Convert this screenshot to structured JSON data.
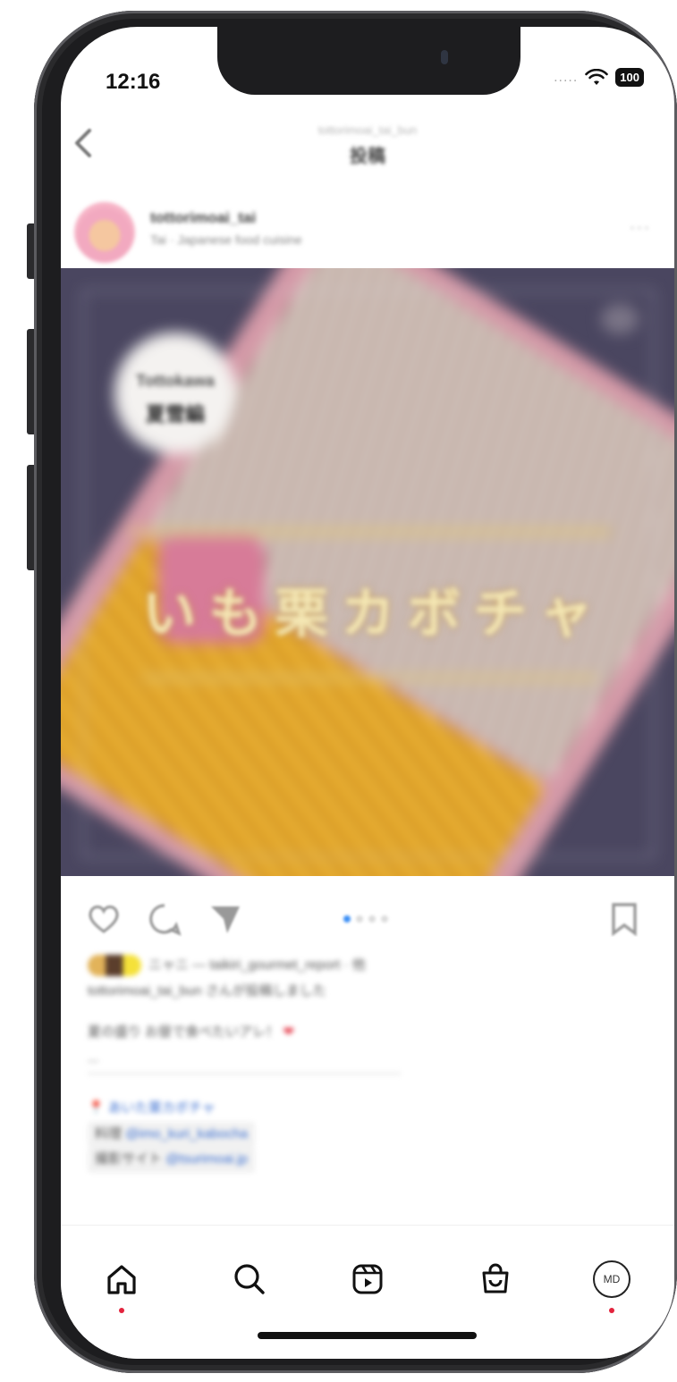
{
  "status_bar": {
    "time": "12:16",
    "signal_dots": ".....",
    "battery": "100"
  },
  "header": {
    "username": "tottorimoai_tai_bun",
    "title": "投稿"
  },
  "post": {
    "author": "tottorimoai_tai",
    "subtitle": "Tai · Japanese food cuisine",
    "more": "···",
    "image": {
      "badge_top": "Tottokawa",
      "badge_bottom": "夏雪編",
      "headline": "いも栗カボチャ"
    }
  },
  "caption": {
    "liked_by": "ニャニ — taikiri_gourmet_report · 他",
    "liked_by_line2": "tottorimoai_tai_bun さんが投稿しました",
    "body": "夏の盛り お昼で食べたいアレ！ ",
    "body_line2": "...",
    "location_pin": "📍",
    "location": "あいた栗カボチャ",
    "credit1_label": "料理",
    "credit1_handle": "@imo_kuri_kabocha",
    "credit2_label": "撮影サイト",
    "credit2_handle": "@tsurimoai.jp"
  },
  "bottom_nav": {
    "profile_initials": "MD"
  },
  "colors": {
    "notification_dot": "#e3233d",
    "pager_active": "#3a8ef5"
  },
  "icons": [
    "back-arrow-icon",
    "heart-icon",
    "comment-icon",
    "share-icon",
    "bookmark-icon",
    "home-icon",
    "search-icon",
    "reels-icon",
    "shop-icon",
    "profile-icon"
  ]
}
